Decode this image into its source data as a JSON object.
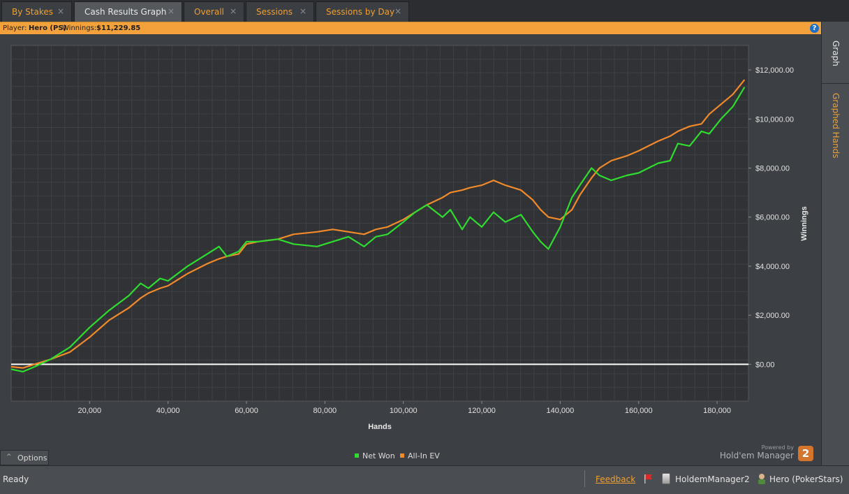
{
  "tabs": [
    {
      "label": "By Stakes",
      "active": false
    },
    {
      "label": "Cash Results Graph",
      "active": true
    },
    {
      "label": "Overall",
      "active": false
    },
    {
      "label": "Sessions",
      "active": false
    },
    {
      "label": "Sessions by Day",
      "active": false
    }
  ],
  "tab_close_glyph": "×",
  "info": {
    "player_label": "Player:",
    "player_name": "Hero (PS)",
    "winnings_label": "Winnings:",
    "winnings_value": "$11,229.85",
    "help_glyph": "?"
  },
  "side_tabs": [
    "Graph",
    "Graphed Hands"
  ],
  "options": {
    "label": "Options",
    "icon": "chevron-up-icon"
  },
  "legend": [
    {
      "label": "Net Won",
      "color": "#2fdc2f"
    },
    {
      "label": "All-In EV",
      "color": "#f28a2a"
    }
  ],
  "brand": {
    "powered_by": "Powered by",
    "name": "Hold'em Manager",
    "logo_text": "2"
  },
  "status": {
    "ready": "Ready",
    "feedback": "Feedback",
    "database": "HoldemManager2",
    "user": "Hero (PokerStars)"
  },
  "colors": {
    "accent": "#f0a030",
    "net_won": "#2fdc2f",
    "all_in_ev": "#f28a2a",
    "zero_line": "#ffffff"
  },
  "chart_data": {
    "type": "line",
    "title": "",
    "xlabel": "Hands",
    "ylabel": "Winnings",
    "xlim": [
      0,
      188000
    ],
    "ylim": [
      -1500,
      13000
    ],
    "x_ticks": [
      {
        "value": 20000,
        "label": "20,000"
      },
      {
        "value": 40000,
        "label": "40,000"
      },
      {
        "value": 60000,
        "label": "60,000"
      },
      {
        "value": 80000,
        "label": "80,000"
      },
      {
        "value": 100000,
        "label": "100,000"
      },
      {
        "value": 120000,
        "label": "120,000"
      },
      {
        "value": 140000,
        "label": "140,000"
      },
      {
        "value": 160000,
        "label": "160,000"
      },
      {
        "value": 180000,
        "label": "180,000"
      }
    ],
    "y_ticks": [
      {
        "value": 0,
        "label": "$0.00"
      },
      {
        "value": 2000,
        "label": "$2,000.00"
      },
      {
        "value": 4000,
        "label": "$4,000.00"
      },
      {
        "value": 6000,
        "label": "$6,000.00"
      },
      {
        "value": 8000,
        "label": "$8,000.00"
      },
      {
        "value": 10000,
        "label": "$10,000.00"
      },
      {
        "value": 12000,
        "label": "$12,000.00"
      }
    ],
    "grid": true,
    "legend_position": "bottom-center",
    "series": [
      {
        "name": "Net Won",
        "x": [
          0,
          3000,
          6000,
          10000,
          15000,
          20000,
          25000,
          30000,
          33000,
          35000,
          38000,
          40000,
          45000,
          50000,
          53000,
          55000,
          58000,
          60000,
          63000,
          68000,
          72000,
          78000,
          82000,
          86000,
          90000,
          93000,
          96000,
          100000,
          103000,
          106000,
          110000,
          112000,
          115000,
          117000,
          120000,
          123000,
          126000,
          130000,
          133000,
          135000,
          137000,
          140000,
          143000,
          145000,
          148000,
          150000,
          153000,
          157000,
          160000,
          165000,
          168000,
          170000,
          173000,
          176000,
          178000,
          181000,
          184000,
          187000
        ],
        "y": [
          -200,
          -300,
          -100,
          200,
          700,
          1500,
          2200,
          2800,
          3300,
          3100,
          3500,
          3400,
          4000,
          4500,
          4800,
          4400,
          4600,
          5000,
          5000,
          5100,
          4900,
          4800,
          5000,
          5200,
          4800,
          5200,
          5300,
          5800,
          6200,
          6500,
          6000,
          6300,
          5500,
          6000,
          5600,
          6200,
          5800,
          6100,
          5400,
          5000,
          4700,
          5600,
          6800,
          7300,
          8000,
          7700,
          7500,
          7700,
          7800,
          8200,
          8300,
          9000,
          8900,
          9500,
          9400,
          10000,
          10500,
          11300
        ]
      },
      {
        "name": "All-In EV",
        "x": [
          0,
          3000,
          6000,
          10000,
          15000,
          20000,
          25000,
          30000,
          33000,
          35000,
          38000,
          40000,
          45000,
          50000,
          53000,
          55000,
          58000,
          60000,
          63000,
          68000,
          72000,
          78000,
          82000,
          86000,
          90000,
          93000,
          96000,
          100000,
          103000,
          106000,
          110000,
          112000,
          115000,
          117000,
          120000,
          123000,
          126000,
          130000,
          133000,
          135000,
          137000,
          140000,
          143000,
          145000,
          148000,
          150000,
          153000,
          157000,
          160000,
          165000,
          168000,
          170000,
          173000,
          176000,
          178000,
          181000,
          184000,
          187000
        ],
        "y": [
          -100,
          -150,
          0,
          200,
          500,
          1100,
          1800,
          2300,
          2700,
          2900,
          3100,
          3200,
          3700,
          4100,
          4300,
          4400,
          4500,
          4900,
          5000,
          5100,
          5300,
          5400,
          5500,
          5400,
          5300,
          5500,
          5600,
          5900,
          6200,
          6500,
          6800,
          7000,
          7100,
          7200,
          7300,
          7500,
          7300,
          7100,
          6700,
          6300,
          6000,
          5900,
          6300,
          6900,
          7600,
          8000,
          8300,
          8500,
          8700,
          9100,
          9300,
          9500,
          9700,
          9800,
          10200,
          10600,
          11000,
          11600
        ]
      }
    ]
  }
}
